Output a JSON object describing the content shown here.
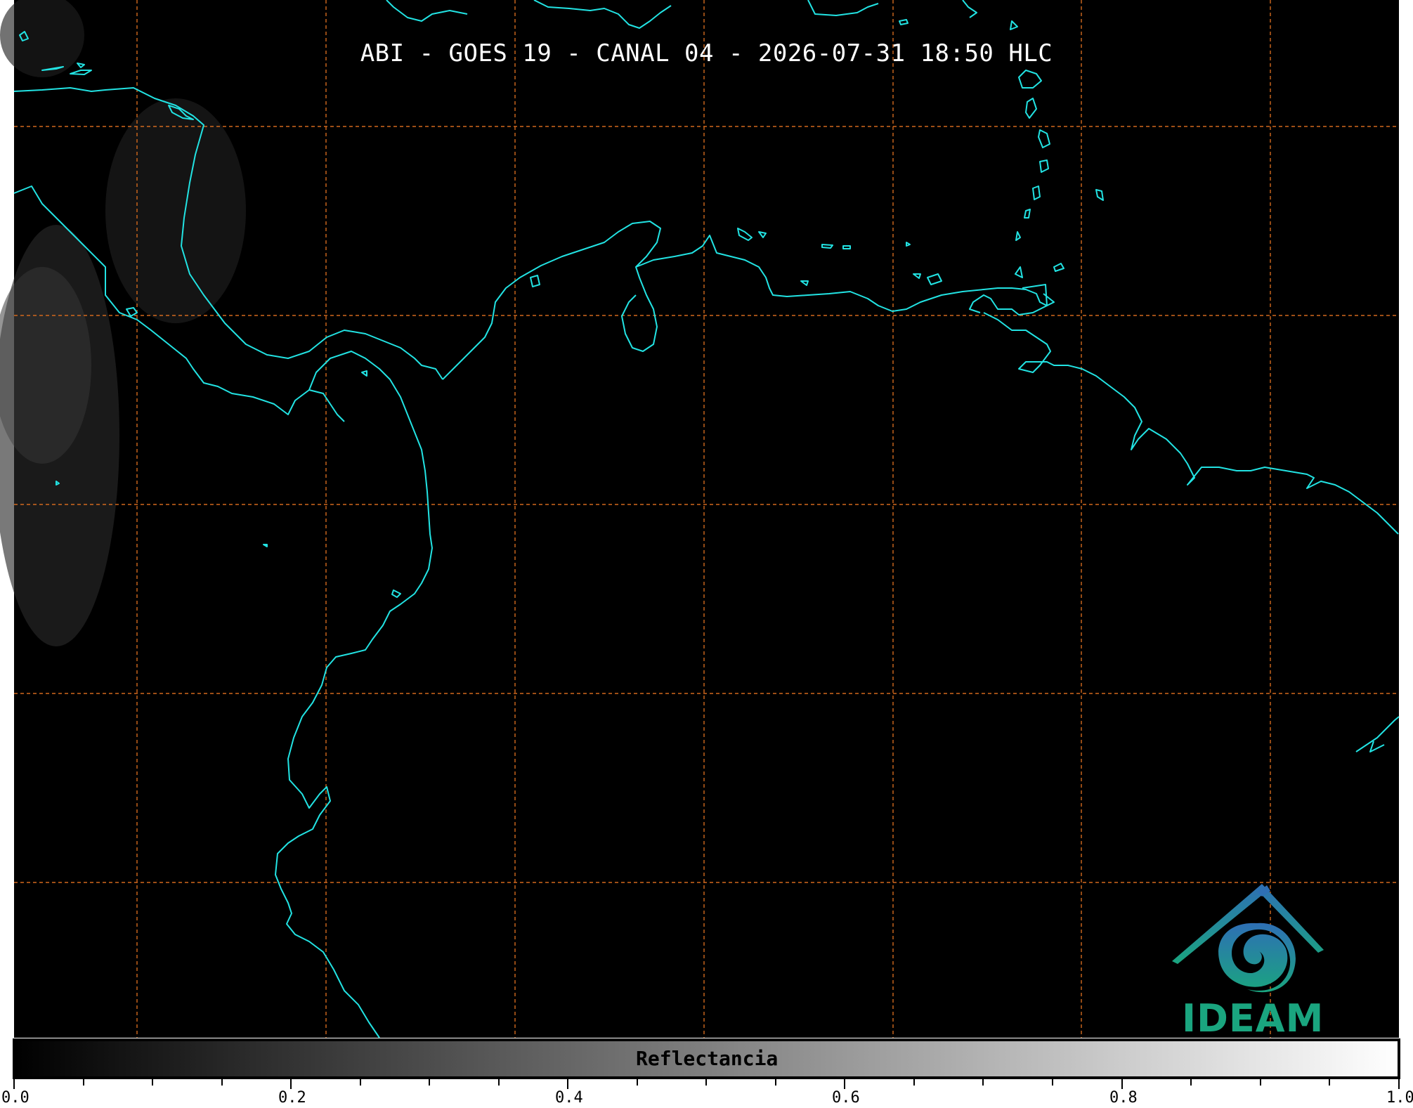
{
  "title": "ABI - GOES 19 - CANAL 04 - 2026-07-31 18:50 HLC",
  "colorbar": {
    "label": "Reflectancia",
    "range": [
      0.0,
      1.0
    ],
    "tick_labels": [
      "0.0",
      "0.2",
      "0.4",
      "0.6",
      "0.8",
      "1.0"
    ],
    "colormap": "grayscale"
  },
  "logo": {
    "text": "IDEAM",
    "colors": [
      "#2e6fb5",
      "#1aa57f"
    ]
  },
  "colors": {
    "background": "#000000",
    "coastline": "#22e3e3",
    "gridlines": "#d2691e"
  }
}
